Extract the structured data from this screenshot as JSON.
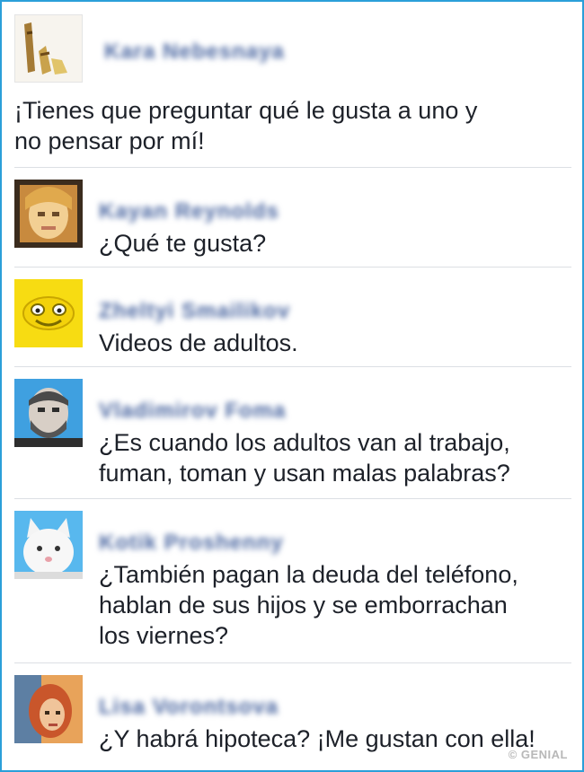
{
  "comments": [
    {
      "author": "Kara Nebesnaya",
      "avatar_icon": "sandals-photo-icon",
      "lines": [
        "¡Tienes que preguntar qué le gusta a uno y",
        "no pensar por mí!"
      ]
    },
    {
      "author": "Kayan Reynolds",
      "avatar_icon": "blonde-person-photo-icon",
      "lines": [
        "¿Qué te gusta?"
      ]
    },
    {
      "author": "Zheltyi Smailikov",
      "avatar_icon": "yellow-smiley-icon",
      "lines": [
        "Videos de adultos."
      ]
    },
    {
      "author": "Vladimirov Foma",
      "avatar_icon": "bearded-man-photo-icon",
      "lines": [
        "¿Es cuando los adultos van al trabajo,",
        "fuman, toman y usan malas palabras?"
      ]
    },
    {
      "author": "Kotik Proshenny",
      "avatar_icon": "white-cat-photo-icon",
      "lines": [
        "¿También pagan la deuda del teléfono,",
        "hablan de sus hijos y se emborrachan",
        "los viernes?"
      ]
    },
    {
      "author": "Lisa Vorontsova",
      "avatar_icon": "redhead-photo-icon",
      "lines": [
        "¿Y habrá hipoteca? ¡Me gustan con ella!"
      ]
    }
  ],
  "watermark": "© GENIAL"
}
